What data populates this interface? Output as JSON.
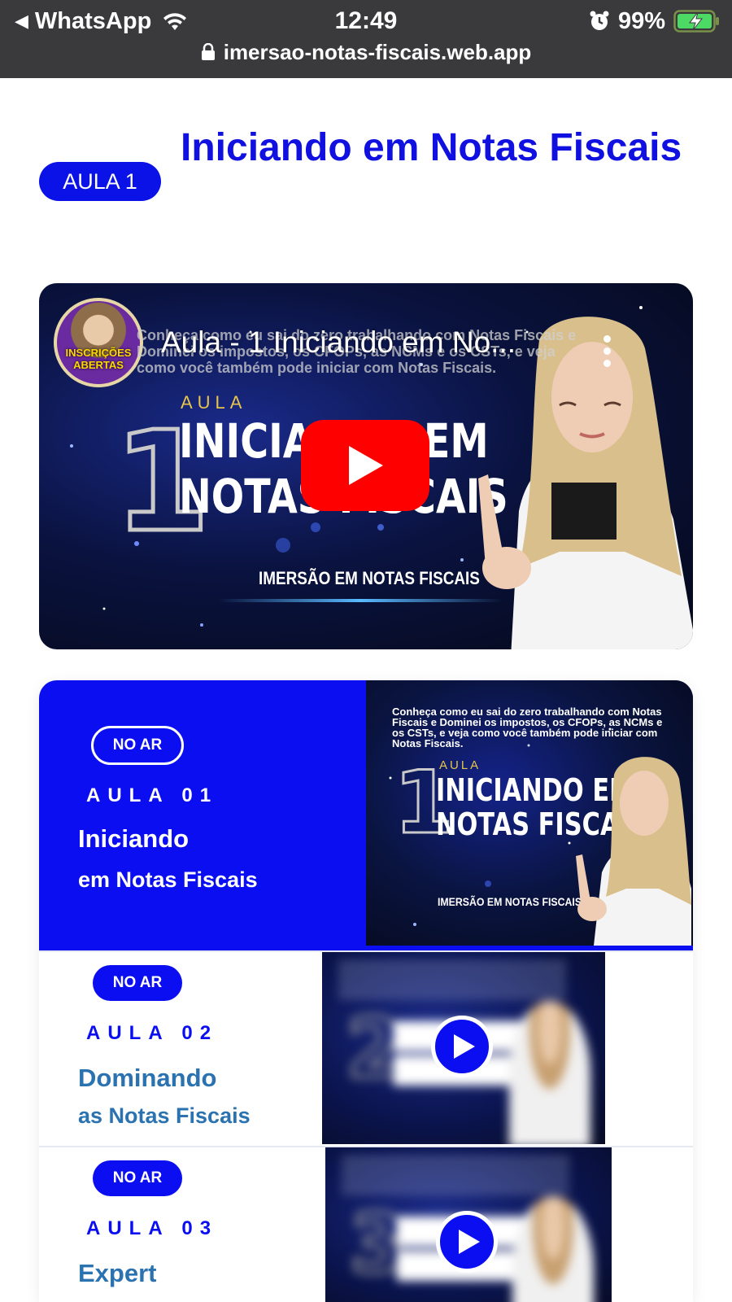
{
  "status_bar": {
    "back_app": "WhatsApp",
    "time": "12:49",
    "battery": "99%",
    "url": "imersao-notas-fiscais.web.app"
  },
  "header": {
    "badge": "AULA 1",
    "title": "Iniciando em Notas Fiscais"
  },
  "video": {
    "title": "Aula - 1 Iniciando em No...",
    "subtitle": "Conheça como eu sai do zero trabalhando com Notas Fiscais e Dominei os impostos, os CFOPs, as NCMs e os CSTs, e veja como você também pode iniciar com Notas Fiscais.",
    "avatar_badge": "INSCRIÇÕES ABERTAS",
    "thumb_number": "1",
    "thumb_kicker": "AULA",
    "thumb_headline_1": "INICIANDO EM",
    "thumb_headline_2": "NOTAS FISCAIS",
    "thumb_brand": "IMERSÃO EM NOTAS FISCAIS"
  },
  "lessons": [
    {
      "status": "NO AR",
      "number": "AULA 01",
      "title": "Iniciando",
      "subtitle": "em Notas Fiscais",
      "thumb_desc": "Conheça como eu sai do zero trabalhando com Notas Fiscais e Dominei os impostos, os CFOPs, as NCMs e os CSTs, e veja como você também pode iniciar com Notas Fiscais.",
      "thumb_number": "1",
      "thumb_kicker": "AULA",
      "thumb_headline_1": "INICIANDO EM",
      "thumb_headline_2": "NOTAS FISCAIS",
      "thumb_brand": "IMERSÃO EM NOTAS FISCAIS"
    },
    {
      "status": "NO AR",
      "number": "AULA 02",
      "title": "Dominando",
      "subtitle": "as Notas Fiscais",
      "thumb_number": "2"
    },
    {
      "status": "NO AR",
      "number": "AULA 03",
      "title": "Expert",
      "thumb_number": "3"
    }
  ],
  "colors": {
    "brand_blue": "#0a0ef0",
    "title_blue": "#1010e0",
    "teal_title": "#2a72b0",
    "youtube_red": "#ff0000"
  }
}
